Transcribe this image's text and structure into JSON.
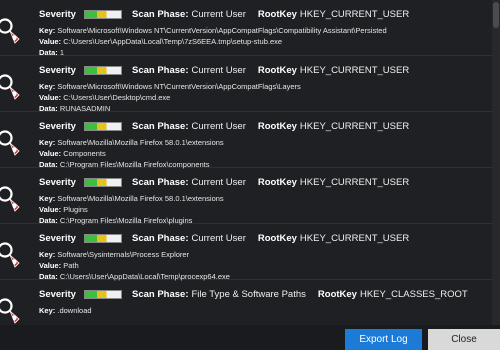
{
  "entries": [
    {
      "severity_label": "Severity",
      "scan_phase_label": "Scan Phase:",
      "scan_phase": "Current User",
      "rootkey_label": "RootKey",
      "rootkey": "HKEY_CURRENT_USER",
      "key_label": "Key:",
      "key": "Software\\Microsoft\\Windows NT\\CurrentVersion\\AppCompatFlags\\Compatibility Assistant\\Persisted",
      "value_label": "Value:",
      "value": "C:\\Users\\User\\AppData\\Local\\Temp\\7zS6EEA.tmp\\setup-stub.exe",
      "data_label": "Data:",
      "data": "1"
    },
    {
      "severity_label": "Severity",
      "scan_phase_label": "Scan Phase:",
      "scan_phase": "Current User",
      "rootkey_label": "RootKey",
      "rootkey": "HKEY_CURRENT_USER",
      "key_label": "Key:",
      "key": "Software\\Microsoft\\Windows NT\\CurrentVersion\\AppCompatFlags\\Layers",
      "value_label": "Value:",
      "value": "C:\\Users\\User\\Desktop\\cmd.exe",
      "data_label": "Data:",
      "data": "RUNASADMIN"
    },
    {
      "severity_label": "Severity",
      "scan_phase_label": "Scan Phase:",
      "scan_phase": "Current User",
      "rootkey_label": "RootKey",
      "rootkey": "HKEY_CURRENT_USER",
      "key_label": "Key:",
      "key": "Software\\Mozilla\\Mozilla Firefox 58.0.1\\extensions",
      "value_label": "Value:",
      "value": "Components",
      "data_label": "Data:",
      "data": "C:\\Program Files\\Mozilla Firefox\\components"
    },
    {
      "severity_label": "Severity",
      "scan_phase_label": "Scan Phase:",
      "scan_phase": "Current User",
      "rootkey_label": "RootKey",
      "rootkey": "HKEY_CURRENT_USER",
      "key_label": "Key:",
      "key": "Software\\Mozilla\\Mozilla Firefox 58.0.1\\extensions",
      "value_label": "Value:",
      "value": "Plugins",
      "data_label": "Data:",
      "data": "C:\\Program Files\\Mozilla Firefox\\plugins"
    },
    {
      "severity_label": "Severity",
      "scan_phase_label": "Scan Phase:",
      "scan_phase": "Current User",
      "rootkey_label": "RootKey",
      "rootkey": "HKEY_CURRENT_USER",
      "key_label": "Key:",
      "key": "Software\\Sysinternals\\Process Explorer",
      "value_label": "Value:",
      "value": "Path",
      "data_label": "Data:",
      "data": "C:\\Users\\User\\AppData\\Local\\Temp\\procexp64.exe"
    },
    {
      "severity_label": "Severity",
      "scan_phase_label": "Scan Phase:",
      "scan_phase": "File Type & Software Paths",
      "rootkey_label": "RootKey",
      "rootkey": "HKEY_CLASSES_ROOT",
      "key_label": "Key:",
      "key": ".download",
      "value_label": "",
      "value": "",
      "data_label": "",
      "data": ""
    }
  ],
  "footer": {
    "export_label": "Export Log",
    "close_label": "Close"
  },
  "colors": {
    "background": "#1f2023",
    "export_button": "#1b7bd6",
    "close_button": "#d9d9d9",
    "icon_red": "#d83a3a"
  },
  "icons": {
    "entry_icon": "magnifier-with-shield-icon"
  }
}
